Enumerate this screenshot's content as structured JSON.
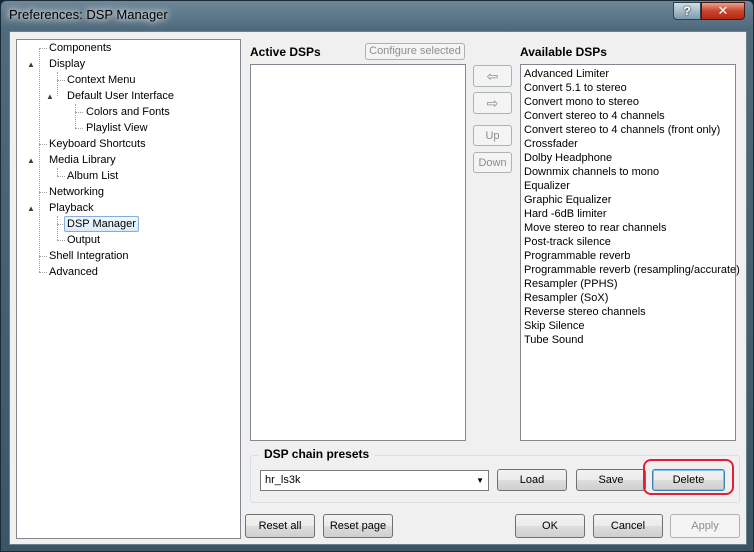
{
  "window": {
    "title": "Preferences: DSP Manager",
    "help_glyph": "?",
    "close_glyph": "✕"
  },
  "tree": {
    "items": [
      {
        "label": "Components"
      },
      {
        "label": "Display",
        "expander": "▲"
      },
      {
        "label": "Context Menu"
      },
      {
        "label": "Default User Interface",
        "expander": "▲"
      },
      {
        "label": "Colors and Fonts"
      },
      {
        "label": "Playlist View"
      },
      {
        "label": "Keyboard Shortcuts"
      },
      {
        "label": "Media Library",
        "expander": "▲"
      },
      {
        "label": "Album List"
      },
      {
        "label": "Networking"
      },
      {
        "label": "Playback",
        "expander": "▲"
      },
      {
        "label": "DSP Manager"
      },
      {
        "label": "Output"
      },
      {
        "label": "Shell Integration"
      },
      {
        "label": "Advanced"
      }
    ]
  },
  "active": {
    "title": "Active DSPs",
    "configure_label": "Configure selected"
  },
  "middle_buttons": {
    "left_arrow": "⇦",
    "right_arrow": "⇨",
    "up": "Up",
    "down": "Down"
  },
  "available": {
    "title": "Available DSPs",
    "items": [
      "Advanced Limiter",
      "Convert 5.1 to stereo",
      "Convert mono to stereo",
      "Convert stereo to 4 channels",
      "Convert stereo to 4 channels (front only)",
      "Crossfader",
      "Dolby Headphone",
      "Downmix channels to mono",
      "Equalizer",
      "Graphic Equalizer",
      "Hard -6dB limiter",
      "Move stereo to rear channels",
      "Post-track silence",
      "Programmable reverb",
      "Programmable reverb (resampling/accurate)",
      "Resampler (PPHS)",
      "Resampler (SoX)",
      "Reverse stereo channels",
      "Skip Silence",
      "Tube Sound"
    ]
  },
  "presets": {
    "title": "DSP chain presets",
    "selected": "hr_ls3k",
    "dropdown_glyph": "▼",
    "load": "Load",
    "save": "Save",
    "delete": "Delete"
  },
  "footer": {
    "reset_all": "Reset all",
    "reset_page": "Reset page",
    "ok": "OK",
    "cancel": "Cancel",
    "apply": "Apply"
  }
}
